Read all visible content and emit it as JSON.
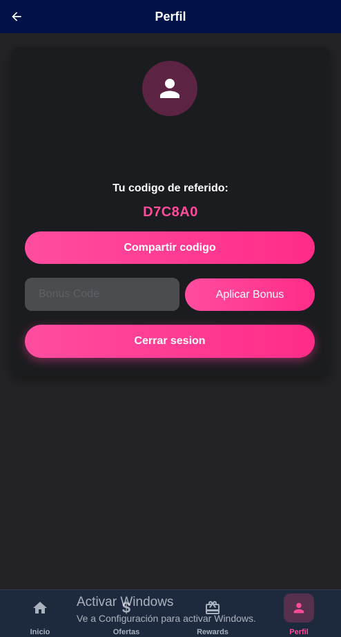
{
  "header": {
    "title": "Perfil",
    "back_icon": "arrow-left-icon"
  },
  "profile": {
    "avatar_icon": "user-icon",
    "referral_label": "Tu codigo de referido:",
    "referral_code": "D7C8A0"
  },
  "actions": {
    "share_label": "Compartir codigo",
    "bonus_placeholder": "Bonus Code",
    "bonus_value": "",
    "apply_label": "Aplicar Bonus",
    "logout_label": "Cerrar sesion"
  },
  "bottom_nav": {
    "items": [
      {
        "label": "Inicio",
        "icon": "home-icon",
        "active": false
      },
      {
        "label": "Ofertas",
        "icon": "dollar-icon",
        "active": false
      },
      {
        "label": "Rewards",
        "icon": "gift-icon",
        "active": false
      },
      {
        "label": "Perfil",
        "icon": "user-icon",
        "active": true
      }
    ]
  },
  "watermark": {
    "title": "Activar Windows",
    "subtitle": "Ve a Configuración para activar Windows."
  },
  "colors": {
    "header_bg": "#001247",
    "accent": "#ff3d93",
    "card_bg": "#1b1c1f",
    "nav_bg": "#1d2a3e"
  }
}
